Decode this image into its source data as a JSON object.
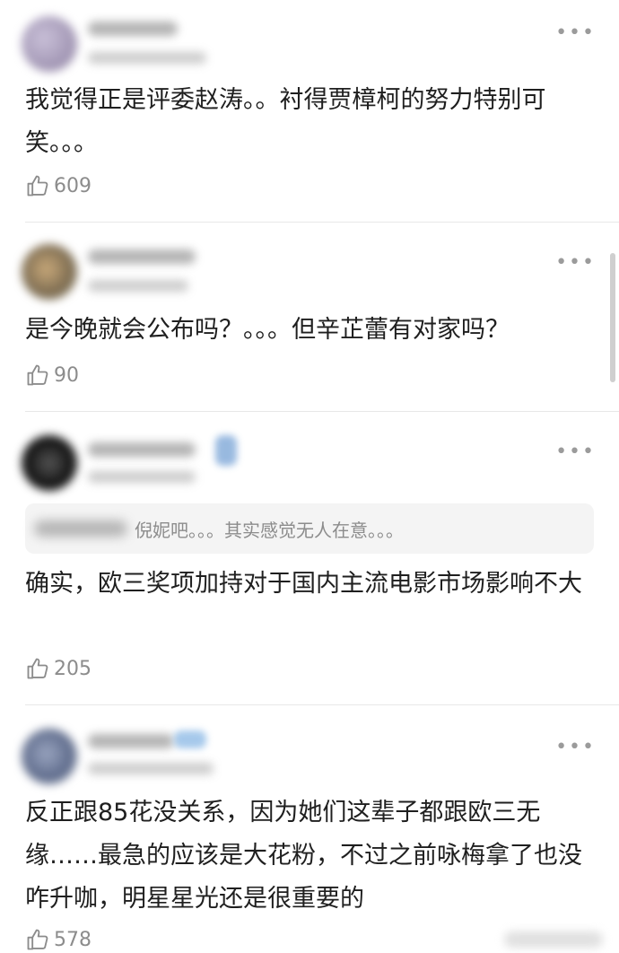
{
  "comments": [
    {
      "text": "我觉得正是评委赵涛。。衬得贾樟柯的努力特别可笑。。。",
      "likes": "609"
    },
    {
      "text": "是今晚就会公布吗？。。。但辛芷蕾有对家吗？",
      "likes": "90"
    },
    {
      "quote": "倪妮吧。。。其实感觉无人在意。。。",
      "text": "确实，欧三奖项加持对于国内主流电影市场影响不大",
      "likes": "205"
    },
    {
      "text": "反正跟85花没关系，因为她们这辈子都跟欧三无缘……最急的应该是大花粉，不过之前咏梅拿了也没咋升咖，明星星光还是很重要的",
      "likes": "578"
    }
  ],
  "icons": {
    "more": "more-dots-icon",
    "like": "thumbs-up-icon"
  }
}
